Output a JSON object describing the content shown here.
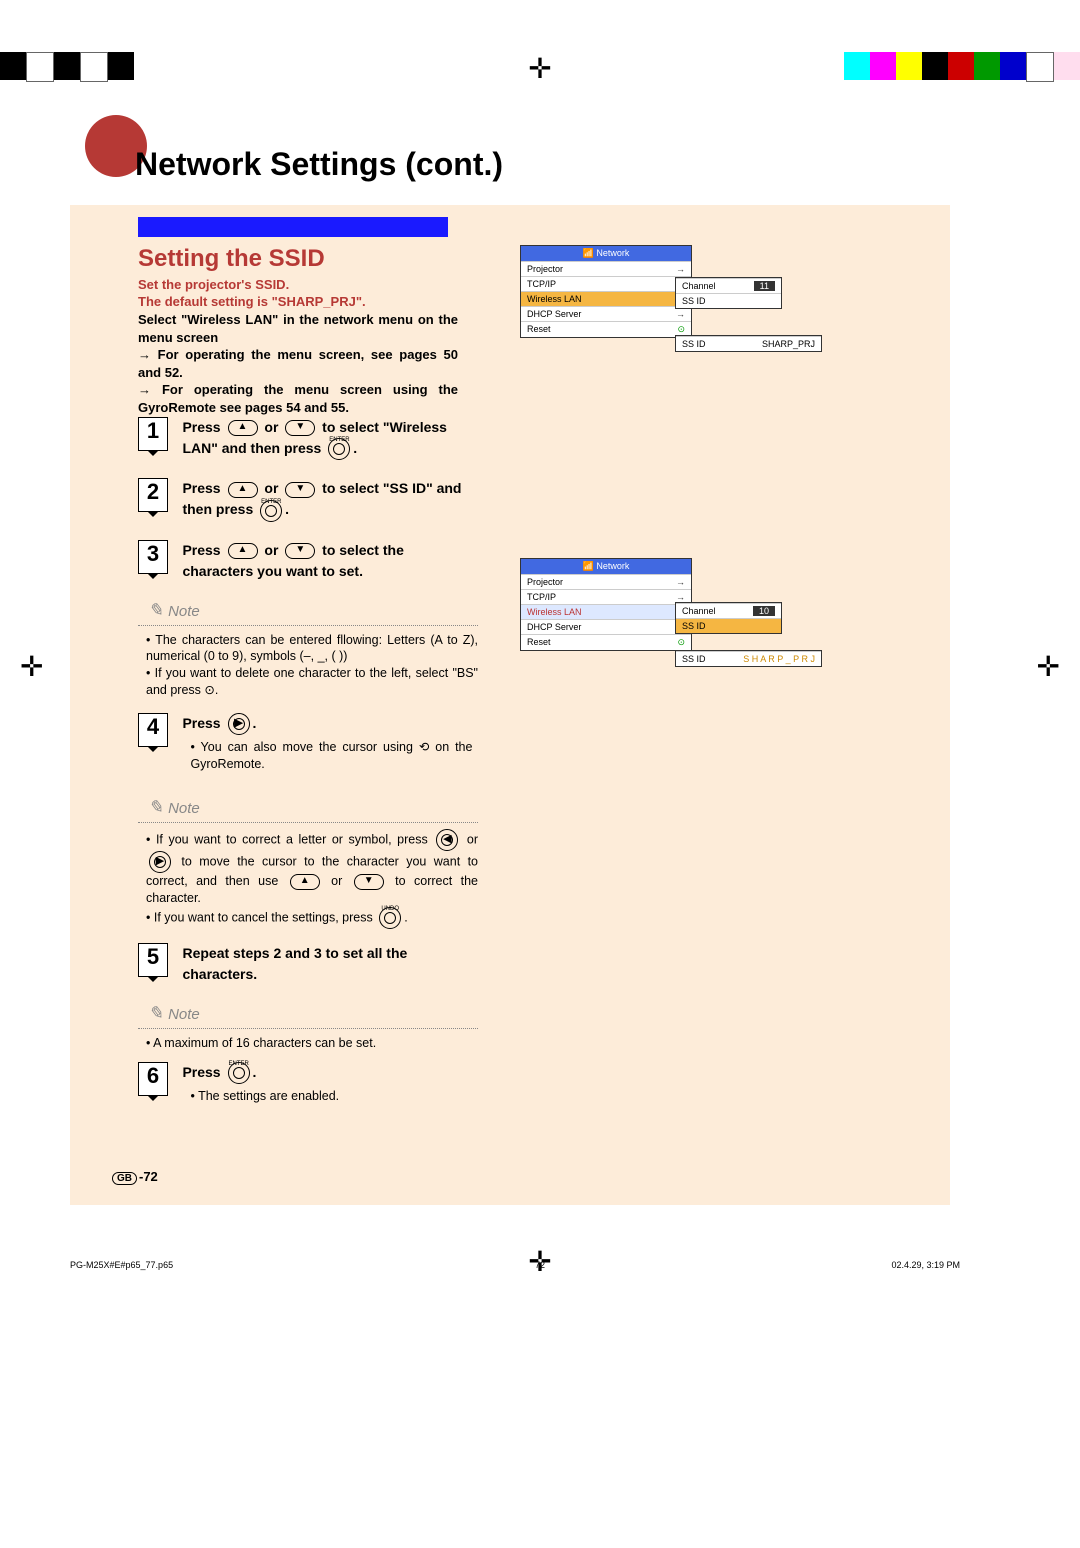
{
  "header": {
    "title": "Network Settings (cont.)"
  },
  "section": {
    "title": "Setting the SSID",
    "red_intro": "Set the projector's SSID.\nThe default setting is \"SHARP_PRJ\".",
    "black_intro": "Select \"Wireless LAN\" in the network menu on the menu screen\n→ For operating the menu screen, see pages 50 and 52.\n→ For operating the menu screen using the GyroRemote see pages 54 and 55."
  },
  "steps": [
    {
      "n": "1",
      "text": "Press ▲ or ▼ to select \"Wireless LAN\" and then press ⊙."
    },
    {
      "n": "2",
      "text": "Press ▲ or ▼ to select \"SS ID\" and then press ⊙."
    },
    {
      "n": "3",
      "text": "Press ▲ or ▼ to select the characters you want to set."
    }
  ],
  "notes": [
    [
      "The characters can be entered fllowing: Letters (A to Z), numerical (0 to 9), symbols (–, _, ( ))",
      "If you want to delete one character to the left, select \"BS\" and press ⊙."
    ],
    [
      "If you want to correct a letter or symbol, press ◀ or ▶ to move the cursor to the character you want to correct, and then use ▲ or ▼ to correct the character.",
      "If you want to cancel the settings, press ⊙."
    ],
    [
      "A maximum of 16 characters can be set."
    ]
  ],
  "step4": {
    "n": "4",
    "text": "Press ▶.",
    "sub": "You can also move the cursor using ⟲ on the GyroRemote."
  },
  "step5": {
    "n": "5",
    "text": "Repeat steps 2 and 3 to set all the characters."
  },
  "step6": {
    "n": "6",
    "text": "Press ⊙.",
    "sub": "The settings are enabled."
  },
  "note_label": "Note",
  "menu": {
    "header": "Network",
    "rows": [
      "Projector",
      "TCP/IP",
      "Wireless LAN",
      "DHCP Server",
      "Reset"
    ],
    "sub1_rows": [
      [
        "Channel",
        "11"
      ],
      [
        "SS ID",
        ""
      ]
    ],
    "sub1b": [
      "SS ID",
      "SHARP_PRJ"
    ],
    "sub2_rows": [
      [
        "Channel",
        "10"
      ],
      [
        "SS ID",
        ""
      ]
    ],
    "sub2b": [
      "SS ID",
      "S H A R P _ P R J"
    ]
  },
  "footer": {
    "page_num": "-72",
    "gb": "GB",
    "file": "PG-M25X#E#p65_77.p65",
    "fold": "72",
    "date": "02.4.29, 3:19 PM"
  },
  "icons": {
    "enter": "ENTER",
    "undo": "UNDO"
  }
}
